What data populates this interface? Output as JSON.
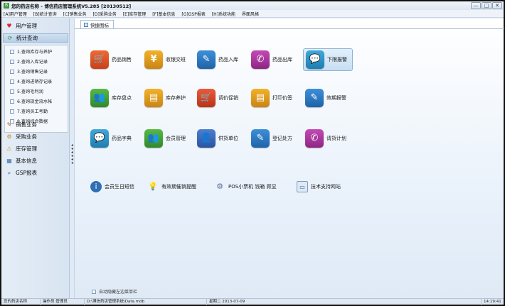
{
  "window": {
    "title": "您的药店名称 - 博信药店管理系统V5.285 [20130512]",
    "controls": {
      "minimize": "—",
      "maximize": "□",
      "close": "✕"
    }
  },
  "menubar": [
    "[A]用户管理",
    "[B]统计查询",
    "[C]销售业务",
    "[D]采购业务",
    "[E]库存管理",
    "[F]基本信息",
    "[G]GSP报表",
    "[H]系统功能",
    "界面风格"
  ],
  "sidebar": {
    "sections": [
      {
        "label": "用户管理",
        "icon": "heart-icon"
      },
      {
        "label": "统计查询",
        "icon": "refresh-icon"
      }
    ],
    "sub_items": [
      "1.查询库存与养护",
      "2.查询入库记录",
      "3.查询销售记录",
      "4.查询进销存记录",
      "5.查询毛利润",
      "6.查询现金流水帐",
      "7.查询员工考勤",
      "8.查询综合数据"
    ],
    "lower_sections": [
      {
        "label": "销售业务",
        "icon": "pencil-icon"
      },
      {
        "label": "采购业务",
        "icon": "gears-icon"
      },
      {
        "label": "库存管理",
        "icon": "warning-icon"
      },
      {
        "label": "基本信息",
        "icon": "table-icon"
      },
      {
        "label": "GSP报表",
        "icon": "magnifier-icon"
      }
    ]
  },
  "main": {
    "tab_label": "快捷图标",
    "tiles": [
      {
        "label": "药品销售",
        "icon": "cart-icon"
      },
      {
        "label": "收银交班",
        "icon": "yen-icon"
      },
      {
        "label": "药品入库",
        "icon": "pen-icon"
      },
      {
        "label": "药品出库",
        "icon": "phone-icon"
      },
      {
        "label": "下限报警",
        "icon": "chat-icon"
      },
      {
        "label": "库存盘点",
        "icon": "people-icon"
      },
      {
        "label": "库存养护",
        "icon": "calculator-icon"
      },
      {
        "label": "调价促销",
        "icon": "cart-icon"
      },
      {
        "label": "打印价签",
        "icon": "calculator-icon"
      },
      {
        "label": "效期报警",
        "icon": "pen-icon"
      },
      {
        "label": "药品字典",
        "icon": "chat-icon"
      },
      {
        "label": "会员管理",
        "icon": "people-icon"
      },
      {
        "label": "供货单位",
        "icon": "person-icon"
      },
      {
        "label": "登记处方",
        "icon": "pen-icon"
      },
      {
        "label": "请货计划",
        "icon": "phone-icon"
      }
    ],
    "small_links": [
      {
        "label": "会员生日短信",
        "icon": "info-icon"
      },
      {
        "label": "有效期催销提醒",
        "icon": "bulb-icon"
      },
      {
        "label": "POS小票机 钱箱 顾显",
        "icon": "pos-icon"
      },
      {
        "label": "技术支持网站",
        "icon": "website-icon"
      }
    ],
    "autohide_label": "自动隐藏左边菜单栏"
  },
  "statusbar": {
    "shop": "您的药店名称",
    "operator": "操作员:管理员",
    "path": "D:\\博信药店管理系统\\Data.mdb",
    "date": "星期二 2013-07-09",
    "time": "14:19:41"
  }
}
